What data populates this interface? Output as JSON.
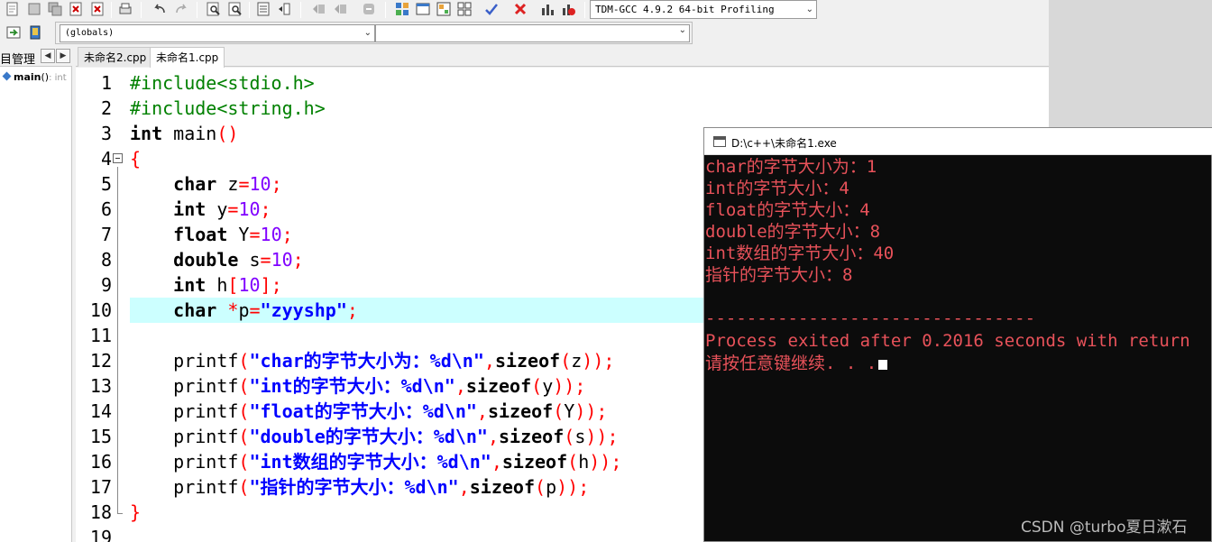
{
  "toolbar": {
    "compiler": "TDM-GCC 4.9.2 64-bit Profiling",
    "scope": "(globals)",
    "function": ""
  },
  "left_panel": {
    "tab_label": "目管理",
    "class_item": {
      "name": "main",
      "signature": "()",
      "return_type": ": int"
    }
  },
  "editor": {
    "tabs": [
      {
        "label": "未命名2.cpp",
        "active": false
      },
      {
        "label": "未命名1.cpp",
        "active": true
      }
    ],
    "line_numbers": [
      "1",
      "2",
      "3",
      "4",
      "5",
      "6",
      "7",
      "8",
      "9",
      "10",
      "11",
      "12",
      "13",
      "14",
      "15",
      "16",
      "17",
      "18",
      "19"
    ],
    "highlighted_line": 10,
    "code": [
      "#include<stdio.h>",
      "#include<string.h>",
      "int main()",
      "{",
      "    char z=10;",
      "    int y=10;",
      "    float Y=10;",
      "    double s=10;",
      "    int h[10];",
      "    char *p=\"zyyshp\";",
      "",
      "    printf(\"char的字节大小为：%d\\n\",sizeof(z));",
      "    printf(\"int的字节大小：%d\\n\",sizeof(y));",
      "    printf(\"float的字节大小：%d\\n\",sizeof(Y));",
      "    printf(\"double的字节大小：%d\\n\",sizeof(s));",
      "    printf(\"int数组的字节大小：%d\\n\",sizeof(h));",
      "    printf(\"指针的字节大小：%d\\n\",sizeof(p));",
      "}",
      ""
    ]
  },
  "console": {
    "title": "D:\\c++\\未命名1.exe",
    "lines": [
      "char的字节大小为：1",
      "int的字节大小：4",
      "float的字节大小：4",
      "double的字节大小：8",
      "int数组的字节大小：40",
      "指针的字节大小：8",
      "",
      "--------------------------------",
      "Process exited after 0.2016 seconds with return",
      "请按任意键继续. . ."
    ],
    "text_color": "#e8525a",
    "background": "#0c0c0c"
  },
  "watermark": "CSDN @turbo夏日漱石"
}
